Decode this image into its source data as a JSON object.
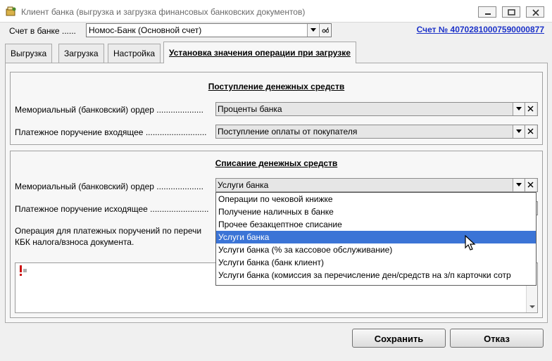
{
  "window": {
    "title": "Клиент банка (выгрузка и загрузка финансовых банковских документов)",
    "icon": "app-icon",
    "controls": [
      "minimize-icon",
      "maximize-icon",
      "close-icon"
    ]
  },
  "account": {
    "label": "Счет в банке ......",
    "selected": "Номос-Банк (Основной счет)",
    "link_text": "Счет № 40702810007590000877"
  },
  "tabs": [
    {
      "label": "Выгрузка",
      "active": false
    },
    {
      "label": "Загрузка",
      "active": false
    },
    {
      "label": "Настройка",
      "active": false
    },
    {
      "label": "Установка значения операции при загрузке",
      "active": true
    }
  ],
  "incoming": {
    "title": "Поступление денежных средств",
    "rows": [
      {
        "label": "Мемориальный (банковский) ордер ....................",
        "value": "Проценты банка"
      },
      {
        "label": "Платежное поручение входящее ..........................",
        "value": "Поступление оплаты от покупателя"
      }
    ]
  },
  "outgoing": {
    "title": "Списание денежных средств",
    "rows": [
      {
        "label": "Мемориальный (банковский) ордер ....................",
        "value": "Услуги банка"
      },
      {
        "label": "Платежное поручение исходящее .........................",
        "value": ""
      }
    ],
    "info_line1": "Операция для платежных поручений по перечи",
    "info_line2": "КБК налога/взноса документа."
  },
  "dropdown": {
    "items": [
      "Операции по чековой книжке",
      "Получение наличных в банке",
      "Прочее безакцептное списание",
      "Услуги банка",
      "Услуги банка (% за кассовое обслуживание)",
      "Услуги банка (банк клиент)",
      "Услуги банка (комиссия за перечисление ден/средств на з/п карточки сотр"
    ],
    "selected_index": 3,
    "selected_color": "#3b74d6"
  },
  "buttons": {
    "save": "Сохранить",
    "cancel": "Отказ"
  },
  "colors": {
    "link": "#1c32c8",
    "warning_icon": "#cc1111"
  }
}
